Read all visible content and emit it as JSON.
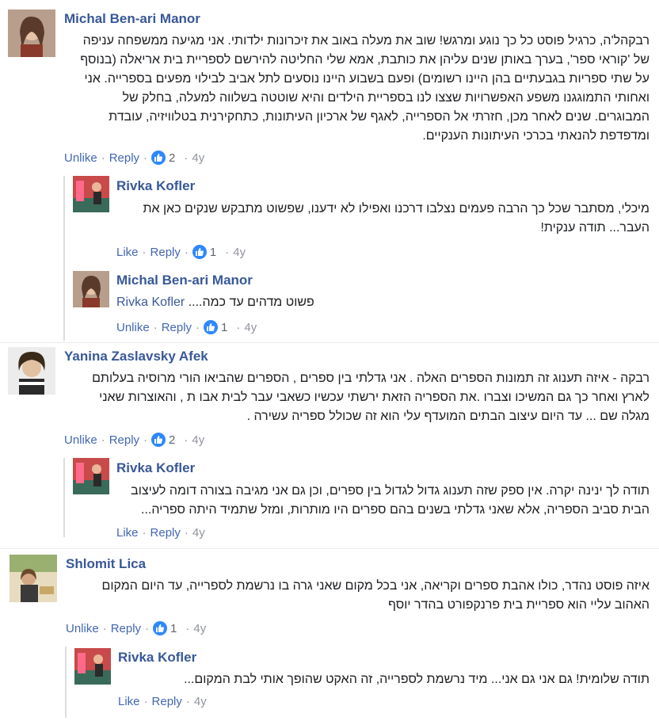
{
  "comments": [
    {
      "name": "Michal Ben-ari Manor",
      "lines": [
        "רבקהל'ה, כרגיל פוסט כל כך נוגע ומרגש! שוב את מעלה באוב את זיכרונות ילדותי. אני מגיעה ממשפחה עניפה",
        "של 'קוראי ספר', בערך באותן שנים עליהן את כותבת, אמא שלי החליטה להירשם לספריית בית אריאלה (בנוסף",
        "על שתי ספריות בגבעתיים בהן היינו רשומים) ופעם בשבוע היינו נוסעים לתל אביב לבילוי מפעים בספרייה. אני",
        "ואחותי התמוגגנו משפע האפשרויות שצצו לנו בספריית הילדים והיא שוטטה בשלווה למעלה, בחלק של",
        "המבוגרים. שנים לאחר מכן, חזרתי אל הספרייה, לאגף של ארכיון העיתונות, כתחקירנית בטלוויזיה, עובדת",
        "ומדפדפת להנאתי בכרכי העיתונות הענקיים."
      ],
      "actions": {
        "like": "Unlike",
        "reply": "Reply",
        "count": "2",
        "time": "4y"
      }
    },
    {
      "name": "Rivka Kofler",
      "lines": [
        "מיכלי, מסתבר שכל כך הרבה פעמים נצלבו דרכנו ואפילו לא ידענו, שפשוט מתבקש שנקים כאן את",
        "העבר... תודה ענקית!"
      ],
      "actions": {
        "like": "Like",
        "reply": "Reply",
        "count": "1",
        "time": "4y"
      }
    },
    {
      "name": "Michal Ben-ari Manor",
      "mention": "Rivka Kofler",
      "text": "פשוט מדהים עד כמה....",
      "actions": {
        "like": "Unlike",
        "reply": "Reply",
        "count": "1",
        "time": "4y"
      }
    },
    {
      "name": "Yanina Zaslavsky Afek",
      "lines": [
        "רבקה - איזה תענוג זה תמונות הספרים האלה . אני גדלתי בין ספרים , הספרים שהביאו הורי מרוסיה בעלותם",
        "לארץ ואחר כך גם המשיכו וצברו .את הספריה הזאת ירשתי עכשיו כשאבי עבר לבית אבו ת , והאוצרות שאני",
        "מגלה שם ... עד היום עיצוב הבתים המועדף עלי הוא זה שכולל ספריה עשירה ."
      ],
      "actions": {
        "like": "Unlike",
        "reply": "Reply",
        "count": "2",
        "time": "4y"
      }
    },
    {
      "name": "Rivka Kofler",
      "lines": [
        "תודה לך ינינה יקרה. אין ספק שזה תענוג גדול לגדול בין ספרים, וכן גם אני מגיבה בצורה דומה לעיצוב",
        "הבית סביב הספריה, אלא שאני גדלתי בשנים בהם ספרים היו מותרות, ומזל שתמיד היתה ספריה..."
      ],
      "actions": {
        "like": "Like",
        "reply": "Reply",
        "time": "4y"
      }
    },
    {
      "name": "Shlomit Lica",
      "lines": [
        "איזה פוסט נהדר, כולו אהבת ספרים וקריאה, אני בכל מקום שאני גרה בו נרשמת לספרייה, עד היום המקום",
        "האהוב עליי הוא ספריית בית פרנקפורט בהדר יוסף"
      ],
      "actions": {
        "like": "Unlike",
        "reply": "Reply",
        "count": "1",
        "time": "4y"
      }
    },
    {
      "name": "Rivka Kofler",
      "lines": [
        "תודה שלומית! גם אני גם אני... מיד נרשמת לספרייה, זה האקט שהופך אותי לבת המקום..."
      ],
      "actions": {
        "like": "Like",
        "reply": "Reply",
        "time": "4y"
      }
    }
  ],
  "colors": {
    "link": "#385898",
    "action": "#4267b2",
    "meta": "#90949c",
    "like_badge": "#2d88ff"
  },
  "icons": {
    "reaction": "thumbs-up-icon"
  }
}
